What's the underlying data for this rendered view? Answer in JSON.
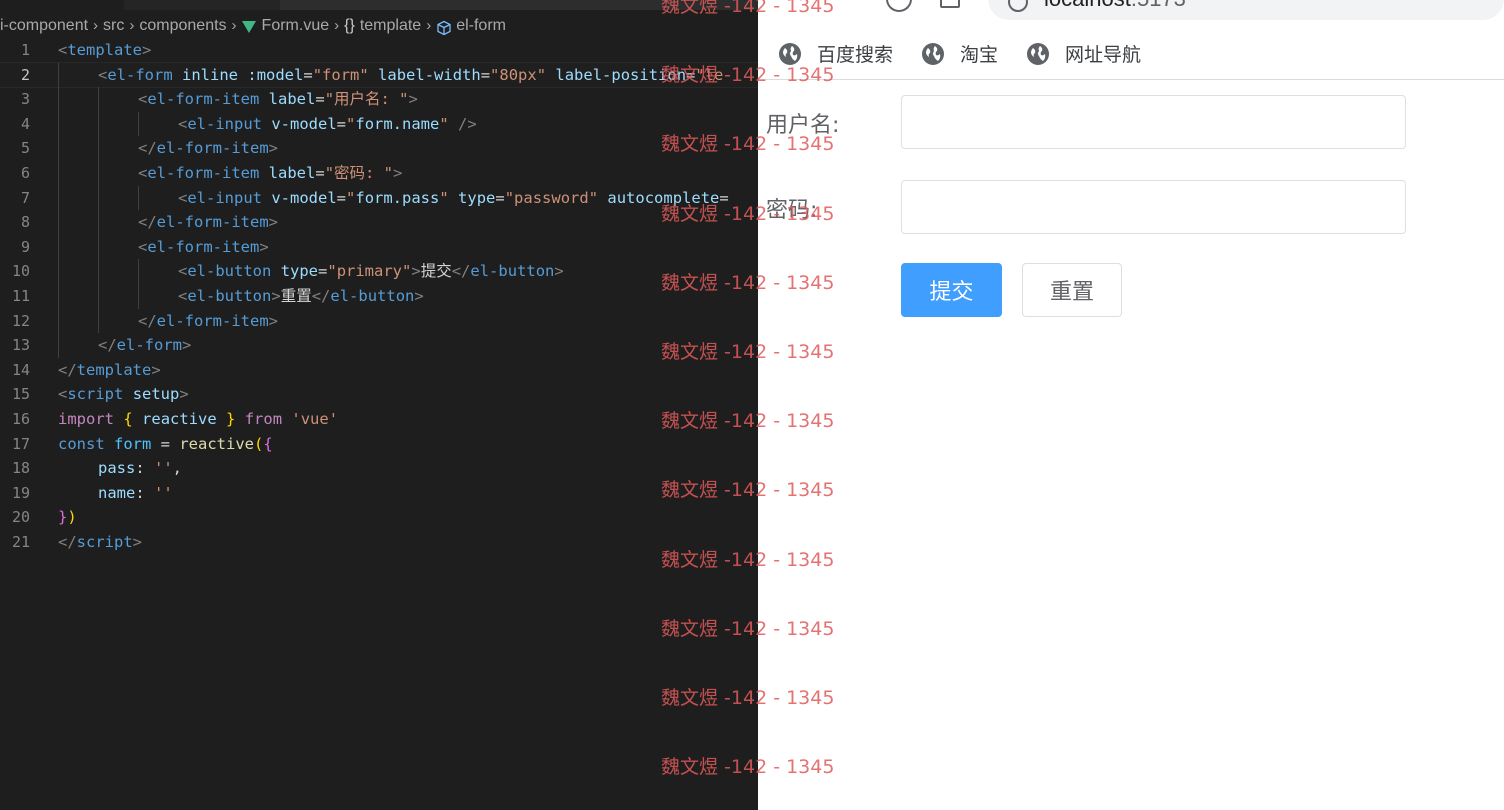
{
  "editor": {
    "breadcrumb": [
      "i-component",
      "src",
      "components",
      "Form.vue",
      "template",
      "el-form"
    ],
    "lines": [
      {
        "n": "1",
        "indent": 0,
        "tokens": [
          [
            "punct",
            "<"
          ],
          [
            "tag",
            "template"
          ],
          [
            "punct",
            ">"
          ]
        ]
      },
      {
        "n": "2",
        "indent": 1,
        "active": true,
        "tokens": [
          [
            "punct",
            "<"
          ],
          [
            "tag",
            "el-form"
          ],
          [
            "plain",
            " "
          ],
          [
            "attr",
            "inline"
          ],
          [
            "plain",
            " "
          ],
          [
            "attr",
            ":model"
          ],
          [
            "plain",
            "="
          ],
          [
            "str",
            "\"form\""
          ],
          [
            "plain",
            " "
          ],
          [
            "attr",
            "label-width"
          ],
          [
            "plain",
            "="
          ],
          [
            "str",
            "\"80px\""
          ],
          [
            "plain",
            " "
          ],
          [
            "attr",
            "label-position"
          ],
          [
            "plain",
            "="
          ],
          [
            "str",
            "\"le"
          ]
        ]
      },
      {
        "n": "3",
        "indent": 2,
        "tokens": [
          [
            "punct",
            "<"
          ],
          [
            "tag",
            "el-form-item"
          ],
          [
            "plain",
            " "
          ],
          [
            "attr",
            "label"
          ],
          [
            "plain",
            "="
          ],
          [
            "str",
            "\"用户名: \""
          ],
          [
            "punct",
            ">"
          ]
        ]
      },
      {
        "n": "4",
        "indent": 3,
        "tokens": [
          [
            "punct",
            "<"
          ],
          [
            "tag",
            "el-input"
          ],
          [
            "plain",
            " "
          ],
          [
            "attr",
            "v-model"
          ],
          [
            "plain",
            "="
          ],
          [
            "str",
            "\""
          ],
          [
            "attr",
            "form.name"
          ],
          [
            "str",
            "\""
          ],
          [
            "plain",
            " "
          ],
          [
            "punct",
            "/>"
          ]
        ]
      },
      {
        "n": "5",
        "indent": 2,
        "tokens": [
          [
            "punct",
            "</"
          ],
          [
            "tag",
            "el-form-item"
          ],
          [
            "punct",
            ">"
          ]
        ]
      },
      {
        "n": "6",
        "indent": 2,
        "tokens": [
          [
            "punct",
            "<"
          ],
          [
            "tag",
            "el-form-item"
          ],
          [
            "plain",
            " "
          ],
          [
            "attr",
            "label"
          ],
          [
            "plain",
            "="
          ],
          [
            "str",
            "\"密码: \""
          ],
          [
            "punct",
            ">"
          ]
        ]
      },
      {
        "n": "7",
        "indent": 3,
        "tokens": [
          [
            "punct",
            "<"
          ],
          [
            "tag",
            "el-input"
          ],
          [
            "plain",
            " "
          ],
          [
            "attr",
            "v-model"
          ],
          [
            "plain",
            "="
          ],
          [
            "str",
            "\""
          ],
          [
            "attr",
            "form.pass"
          ],
          [
            "str",
            "\""
          ],
          [
            "plain",
            " "
          ],
          [
            "attr",
            "type"
          ],
          [
            "plain",
            "="
          ],
          [
            "str",
            "\"password\""
          ],
          [
            "plain",
            " "
          ],
          [
            "attr",
            "autocomplete"
          ],
          [
            "plain",
            "="
          ]
        ]
      },
      {
        "n": "8",
        "indent": 2,
        "tokens": [
          [
            "punct",
            "</"
          ],
          [
            "tag",
            "el-form-item"
          ],
          [
            "punct",
            ">"
          ]
        ]
      },
      {
        "n": "9",
        "indent": 2,
        "tokens": [
          [
            "punct",
            "<"
          ],
          [
            "tag",
            "el-form-item"
          ],
          [
            "punct",
            ">"
          ]
        ]
      },
      {
        "n": "10",
        "indent": 3,
        "tokens": [
          [
            "punct",
            "<"
          ],
          [
            "tag",
            "el-button"
          ],
          [
            "plain",
            " "
          ],
          [
            "attr",
            "type"
          ],
          [
            "plain",
            "="
          ],
          [
            "str",
            "\"primary\""
          ],
          [
            "punct",
            ">"
          ],
          [
            "plain",
            "提交"
          ],
          [
            "punct",
            "</"
          ],
          [
            "tag",
            "el-button"
          ],
          [
            "punct",
            ">"
          ]
        ]
      },
      {
        "n": "11",
        "indent": 3,
        "tokens": [
          [
            "punct",
            "<"
          ],
          [
            "tag",
            "el-button"
          ],
          [
            "punct",
            ">"
          ],
          [
            "plain",
            "重置"
          ],
          [
            "punct",
            "</"
          ],
          [
            "tag",
            "el-button"
          ],
          [
            "punct",
            ">"
          ]
        ]
      },
      {
        "n": "12",
        "indent": 2,
        "tokens": [
          [
            "punct",
            "</"
          ],
          [
            "tag",
            "el-form-item"
          ],
          [
            "punct",
            ">"
          ]
        ]
      },
      {
        "n": "13",
        "indent": 1,
        "tokens": [
          [
            "punct",
            "</"
          ],
          [
            "tag",
            "el-form"
          ],
          [
            "punct",
            ">"
          ]
        ]
      },
      {
        "n": "14",
        "indent": 0,
        "tokens": [
          [
            "punct",
            "</"
          ],
          [
            "tag",
            "template"
          ],
          [
            "punct",
            ">"
          ]
        ]
      },
      {
        "n": "15",
        "indent": 0,
        "tokens": [
          [
            "punct",
            "<"
          ],
          [
            "tag",
            "script"
          ],
          [
            "plain",
            " "
          ],
          [
            "attr",
            "setup"
          ],
          [
            "punct",
            ">"
          ]
        ]
      },
      {
        "n": "16",
        "indent": 0,
        "tokens": [
          [
            "kw",
            "import"
          ],
          [
            "plain",
            " "
          ],
          [
            "br1",
            "{"
          ],
          [
            "plain",
            " "
          ],
          [
            "attr",
            "reactive"
          ],
          [
            "plain",
            " "
          ],
          [
            "br1",
            "}"
          ],
          [
            "plain",
            " "
          ],
          [
            "kw",
            "from"
          ],
          [
            "plain",
            " "
          ],
          [
            "str",
            "'vue'"
          ]
        ]
      },
      {
        "n": "17",
        "indent": 0,
        "tokens": [
          [
            "decl",
            "const"
          ],
          [
            "plain",
            " "
          ],
          [
            "var",
            "form"
          ],
          [
            "plain",
            " = "
          ],
          [
            "fn",
            "reactive"
          ],
          [
            "br1",
            "("
          ],
          [
            "br2",
            "{"
          ]
        ]
      },
      {
        "n": "18",
        "indent": 1,
        "tokens": [
          [
            "attr",
            "pass"
          ],
          [
            "plain",
            ": "
          ],
          [
            "str",
            "''"
          ],
          [
            "plain",
            ","
          ]
        ]
      },
      {
        "n": "19",
        "indent": 1,
        "tokens": [
          [
            "attr",
            "name"
          ],
          [
            "plain",
            ": "
          ],
          [
            "str",
            "''"
          ]
        ]
      },
      {
        "n": "20",
        "indent": 0,
        "tokens": [
          [
            "br2",
            "}"
          ],
          [
            "br1",
            ")"
          ]
        ]
      },
      {
        "n": "21",
        "indent": 0,
        "tokens": [
          [
            "punct",
            "</"
          ],
          [
            "tag",
            "script"
          ],
          [
            "punct",
            ">"
          ]
        ]
      }
    ]
  },
  "browser": {
    "url_host": "localhost",
    "url_port": ":5173",
    "bookmarks": [
      {
        "label": "百度搜索"
      },
      {
        "label": "淘宝"
      },
      {
        "label": "网址导航"
      }
    ],
    "form": {
      "username_label": "用户名:",
      "username_value": "",
      "password_label": "密码:",
      "password_value": "",
      "submit_label": "提交",
      "reset_label": "重置"
    },
    "colors": {
      "primary": "#409eff",
      "border": "#dcdfe6",
      "label": "#606266"
    }
  },
  "watermark": {
    "text": "魏文煜 -142 - 1345",
    "color": "#e05a5a",
    "count": 12
  }
}
